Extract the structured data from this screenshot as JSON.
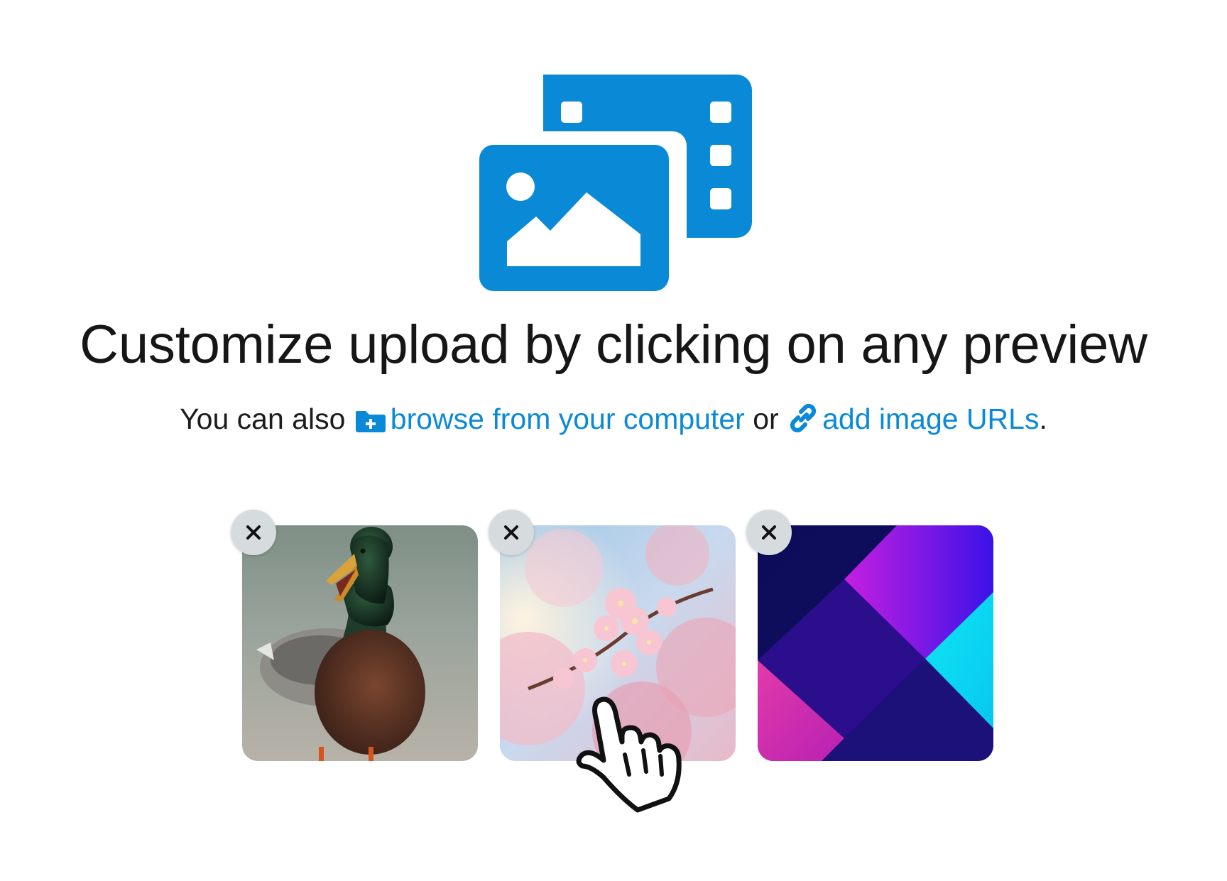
{
  "colors": {
    "accent": "#0a8ad6",
    "remove_button": "#d6dcde",
    "text": "#161616"
  },
  "hero": {
    "icon": "image-and-film-frames-icon"
  },
  "title": "Customize upload by clicking on any preview",
  "subtitle": {
    "prefix": "You can also",
    "browse_icon": "folder-plus-icon",
    "browse_label": "browse from your computer",
    "middle": "or",
    "url_icon": "link-icon",
    "url_label": "add image URLs",
    "suffix": "."
  },
  "previews": [
    {
      "subject": "duck-photo",
      "remove_icon": "close-icon"
    },
    {
      "subject": "cherry-blossom-photo",
      "remove_icon": "close-icon"
    },
    {
      "subject": "abstract-gradient-graphic",
      "remove_icon": "close-icon"
    }
  ],
  "cursor": {
    "icon": "pointer-hand-icon"
  }
}
